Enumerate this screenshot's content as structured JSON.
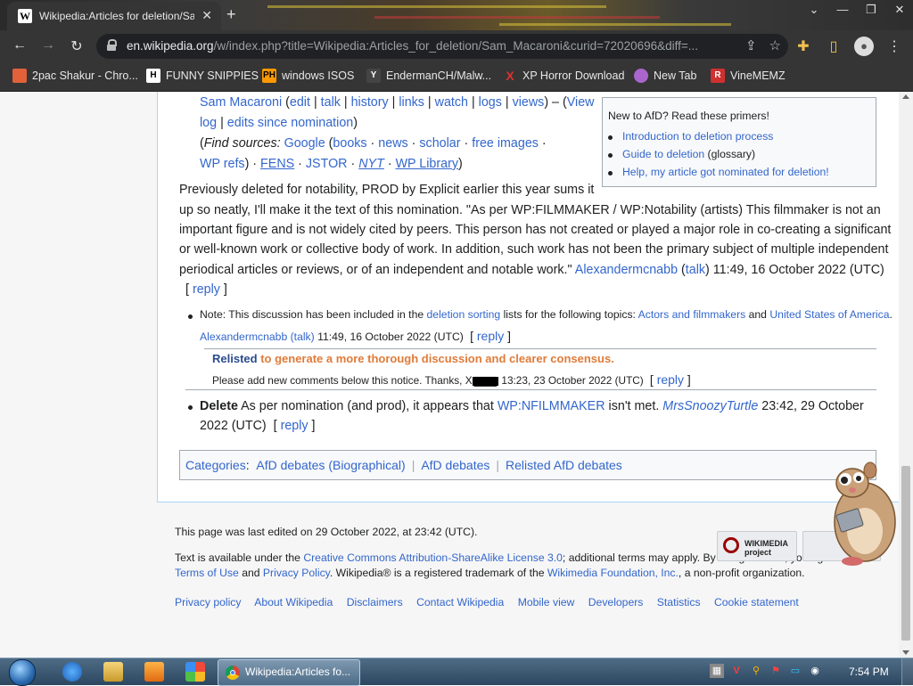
{
  "browser": {
    "tab_title": "Wikipedia:Articles for deletion/Sam Macaroni",
    "tab_favicon": "W",
    "tab_close": "✕",
    "new_tab": "+",
    "url_host": "en.wikipedia.org",
    "url_path": "/w/index.php?title=Wikipedia:Articles_for_deletion/Sam_Macaroni&curid=72020696&diff=...",
    "window_controls": [
      "⌄",
      "—",
      "❐",
      "✕"
    ],
    "nav": {
      "back": "←",
      "forward": "→",
      "reload": "↻"
    }
  },
  "bookmarks": [
    {
      "label": "2pac Shakur - Chro...",
      "icon": "doc-icon",
      "icon_color": "#e0613a"
    },
    {
      "label": "FUNNY SNIPPIES",
      "icon": "H",
      "icon_color": "#ffffff"
    },
    {
      "label": "windows ISOS",
      "icon": "PH",
      "icon_color": "#ff9900"
    },
    {
      "label": "EndermanCH/Malw...",
      "icon": "YT",
      "icon_color": "#444444"
    },
    {
      "label": "XP Horror Download",
      "icon": "X",
      "icon_color": "#e03030"
    },
    {
      "label": "New Tab",
      "icon": "globe-icon",
      "icon_color": "#aa66cc"
    },
    {
      "label": "VineMEMZ",
      "icon": "R",
      "icon_color": "#d03030"
    }
  ],
  "article": {
    "links_line1": {
      "subject": "Sam Macaroni",
      "edit": "edit",
      "talk": "talk",
      "history": "history",
      "links": "links",
      "watch": "watch",
      "logs": "logs",
      "views": "views",
      "view_log": "View",
      "view_log2": "log",
      "edits_since": "edits since nomination"
    },
    "find_sources": {
      "label": "Find sources:",
      "google": "Google",
      "books": "books",
      "news": "news",
      "scholar": "scholar",
      "free_images": "free images",
      "wp_refs": "WP refs",
      "fens": "FENS",
      "jstor": "JSTOR",
      "nyt": "NYT",
      "wp_library": "WP Library"
    },
    "nomination": {
      "line1": "Previously deleted for notability, PROD by Explicit earlier this year sums it",
      "line2": "up so neatly, I'll make it the text of this nomination. \"As per WP:FILMMAKER / WP:Notability (artists) This filmmaker is not an",
      "line3": "important figure and is not widely cited by peers. This person has not created or played a major role in co-creating a significant",
      "line4": "or well-known work or collective body of work. In addition, such work has not been the primary subject of multiple independent",
      "line5_text": "periodical articles or reviews, or of an independent and notable work.\"",
      "user": "Alexandermcnabb",
      "talk": "talk",
      "timestamp": "11:49, 16 October 2022 (UTC)",
      "reply": "reply"
    },
    "note": {
      "prefix": "Note: This discussion has been included in the",
      "link": "deletion sorting",
      "mid": "lists for the following topics:",
      "topic1": "Actors and filmmakers",
      "and": "and",
      "topic2": "United States of America",
      "sig": "Alexandermcnabb (talk)",
      "timestamp": "11:49, 16 October 2022 (UTC)",
      "reply": "reply"
    },
    "relist": {
      "word": "Relisted",
      "reason": "to generate a more thorough discussion and clearer consensus.",
      "line2": "Please add new comments below this notice. Thanks,",
      "user": "X",
      "timestamp": "13:23, 23 October 2022 (UTC)",
      "reply": "reply"
    },
    "delete_vote": {
      "word": "Delete",
      "text": "As per nomination (and prod), it appears that",
      "link": "WP:NFILMMAKER",
      "text2": "isn't met.",
      "user": "MrsSnoozyTurtle",
      "timestamp": "23:42, 29 October",
      "timestamp2": "2022 (UTC)",
      "reply": "reply"
    },
    "primers": {
      "heading": "New to AfD? Read these primers!",
      "items": [
        {
          "label": "Introduction to deletion process",
          "suffix": ""
        },
        {
          "label": "Guide to deletion",
          "suffix": "(glossary)"
        },
        {
          "label": "Help, my article got nominated for deletion!",
          "suffix": ""
        }
      ]
    },
    "categories": {
      "label": "Categories",
      "items": [
        "AfD debates (Biographical)",
        "AfD debates",
        "Relisted AfD debates"
      ]
    }
  },
  "footer": {
    "last_edited": "This page was last edited on 29 October 2022, at 23:42 (UTC).",
    "license_pre": "Text is available under the",
    "license_link": "Creative Commons Attribution-ShareAlike License 3.0",
    "license_post": "; additional terms may apply. By using this site, you agree to the",
    "terms": "Terms of Use",
    "and": "and",
    "privacy": "Privacy Policy",
    "trademark_pre": ". Wikipedia® is a registered trademark of the",
    "foundation": "Wikimedia Foundation, Inc.",
    "trademark_post": ", a non-profit organization.",
    "links": [
      "Privacy policy",
      "About Wikipedia",
      "Disclaimers",
      "Contact Wikipedia",
      "Mobile view",
      "Developers",
      "Statistics",
      "Cookie statement"
    ],
    "wikimedia_logo": "WIKIMEDIA project"
  },
  "taskbar": {
    "chrome_task_label": "Wikipedia:Articles fo...",
    "clock": "7:54 PM"
  },
  "colors": {
    "link": "#3366cc",
    "relist_orange": "#e07b39",
    "relist_blue": "#2a4b8d"
  }
}
